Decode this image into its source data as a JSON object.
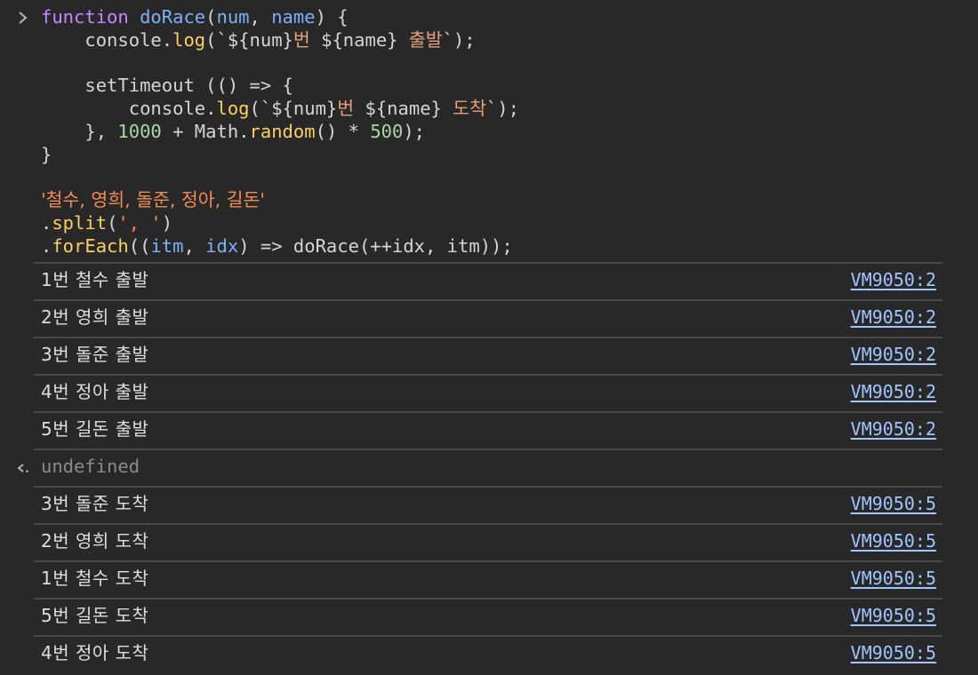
{
  "input": {
    "code_lines": [
      [
        "function",
        " ",
        "doRace",
        "(",
        "num",
        ", ",
        "name",
        ") {"
      ],
      [
        "    console.",
        "log",
        "(`",
        "${",
        "num",
        "}",
        "번",
        " ",
        "${",
        "name",
        "}",
        " ",
        "출발",
        "`);"
      ],
      [
        ""
      ],
      [
        "    setTimeout (() => {"
      ],
      [
        "        console.",
        "log",
        "(`",
        "${",
        "num",
        "}",
        "번",
        " ",
        "${",
        "name",
        "}",
        " ",
        "도착",
        "`);"
      ],
      [
        "    }, ",
        "1000",
        " + Math.",
        "random",
        "() * ",
        "500",
        ");"
      ],
      [
        "}"
      ],
      [
        ""
      ],
      [
        "'철수, 영희, 돌준, 정아, 길돈'"
      ],
      [
        ".",
        "split",
        "(",
        "', '",
        ")"
      ],
      [
        ".",
        "forEach",
        "((",
        "itm",
        ", ",
        "idx",
        ") => doRace(++idx, itm));"
      ]
    ]
  },
  "logs_before": [
    {
      "text": "1번 철수 출발",
      "source": "VM9050:2"
    },
    {
      "text": "2번 영희 출발",
      "source": "VM9050:2"
    },
    {
      "text": "3번 돌준 출발",
      "source": "VM9050:2"
    },
    {
      "text": "4번 정아 출발",
      "source": "VM9050:2"
    },
    {
      "text": "5번 길돈 출발",
      "source": "VM9050:2"
    }
  ],
  "result": {
    "text": "undefined"
  },
  "logs_after": [
    {
      "text": "3번 돌준 도착",
      "source": "VM9050:5"
    },
    {
      "text": "2번 영희 도착",
      "source": "VM9050:5"
    },
    {
      "text": "1번 철수 도착",
      "source": "VM9050:5"
    },
    {
      "text": "5번 길돈 도착",
      "source": "VM9050:5"
    },
    {
      "text": "4번 정아 도착",
      "source": "VM9050:5"
    }
  ],
  "icons": {
    "prompt": "chevron-right-icon",
    "result": "return-arrow-icon"
  },
  "colors": {
    "background": "#282828",
    "keyword": "#c587ff",
    "identifier": "#7fb0f7",
    "method": "#fbcf63",
    "string": "#f28b54",
    "number": "#a7d7a5",
    "link": "#9fc6ff",
    "muted": "#8a8a8a"
  }
}
